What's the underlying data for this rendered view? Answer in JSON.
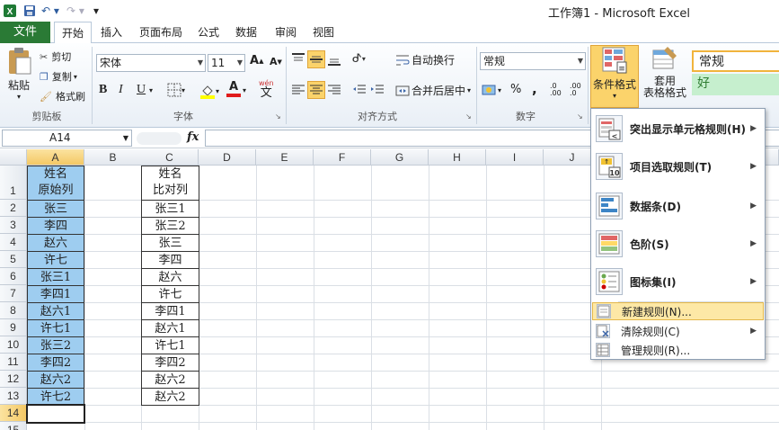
{
  "window": {
    "title": "工作簿1 - Microsoft Excel"
  },
  "tabs": [
    "文件",
    "开始",
    "插入",
    "页面布局",
    "公式",
    "数据",
    "审阅",
    "视图"
  ],
  "ribbon": {
    "clipboard": {
      "paste": "粘贴",
      "cut": "剪切",
      "copy": "复制",
      "format_painter": "格式刷",
      "label": "剪贴板"
    },
    "font": {
      "name": "宋体",
      "size": "11",
      "bold": "B",
      "italic": "I",
      "underline": "U",
      "label": "字体",
      "grow": "A",
      "shrink": "A",
      "font_color": "A",
      "wen": "wén"
    },
    "alignment": {
      "wrap": "自动换行",
      "merge": "合并后居中",
      "label": "对齐方式"
    },
    "number": {
      "format": "常规",
      "percent": "%",
      "comma": ",",
      "inc": ".0 .00",
      "dec": ".00 .0",
      "label": "数字"
    },
    "styles": {
      "conditional": "条件格式",
      "table": "套用",
      "table2": "表格格式",
      "style_normal": "常规",
      "style_good": "好"
    }
  },
  "formula_bar": {
    "namebox": "A14",
    "fx": "fx",
    "value": ""
  },
  "columns": [
    "A",
    "B",
    "C",
    "D",
    "E",
    "F",
    "G",
    "H",
    "I",
    "J"
  ],
  "rows": [
    "1",
    "2",
    "3",
    "4",
    "5",
    "6",
    "7",
    "8",
    "9",
    "10",
    "11",
    "12",
    "13",
    "14",
    "15"
  ],
  "colA_header": [
    "姓名",
    "原始列"
  ],
  "colC_header": [
    "姓名",
    "比对列"
  ],
  "colA": [
    "张三",
    "李四",
    "赵六",
    "许七",
    "张三1",
    "李四1",
    "赵六1",
    "许七1",
    "张三2",
    "李四2",
    "赵六2",
    "许七2"
  ],
  "colC": [
    "张三1",
    "张三2",
    "张三",
    "李四",
    "赵六",
    "许七",
    "李四1",
    "赵六1",
    "许七1",
    "李四2",
    "赵六2",
    "赵六2"
  ],
  "menu": {
    "items": [
      {
        "label": "突出显示单元格规则(H)",
        "icon": "highlight-rules-icon"
      },
      {
        "label": "项目选取规则(T)",
        "icon": "top-bottom-rules-icon"
      },
      {
        "label": "数据条(D)",
        "icon": "data-bars-icon"
      },
      {
        "label": "色阶(S)",
        "icon": "color-scales-icon"
      },
      {
        "label": "图标集(I)",
        "icon": "icon-sets-icon"
      }
    ],
    "small_items": [
      {
        "label": "新建规则(N)...",
        "icon": "new-rule-icon"
      },
      {
        "label": "清除规则(C)",
        "icon": "clear-rules-icon"
      },
      {
        "label": "管理规则(R)...",
        "icon": "manage-rules-icon"
      }
    ]
  },
  "colors": {
    "file_tab": "#2a7a35",
    "selected_col": "#9ecdf0",
    "highlight": "#fde8a6",
    "good_style": "#c6efce"
  }
}
